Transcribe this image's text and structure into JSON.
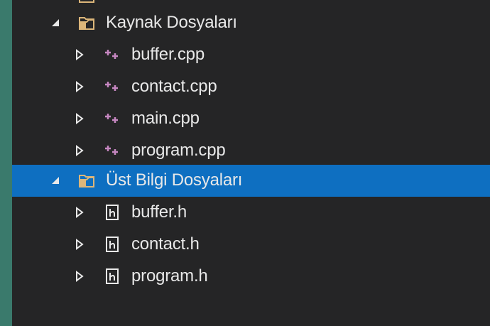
{
  "tree": {
    "items": [
      {
        "kind": "folder",
        "label": "Kaynak Dosyaları",
        "expanded": true,
        "selected": false
      },
      {
        "kind": "cpp",
        "label": "buffer.cpp"
      },
      {
        "kind": "cpp",
        "label": "contact.cpp"
      },
      {
        "kind": "cpp",
        "label": "main.cpp"
      },
      {
        "kind": "cpp",
        "label": "program.cpp"
      },
      {
        "kind": "folder",
        "label": "Üst Bilgi Dosyaları",
        "expanded": true,
        "selected": true
      },
      {
        "kind": "h",
        "label": "buffer.h"
      },
      {
        "kind": "h",
        "label": "contact.h"
      },
      {
        "kind": "h",
        "label": "program.h"
      }
    ]
  },
  "colors": {
    "background": "#252526",
    "selection": "#0e6fc1",
    "left_strip": "#3a7a6c",
    "text": "#e8e8e8",
    "cpp_icon": "#c586c0",
    "folder_icon": "#dcb67a"
  },
  "icons": {
    "folder": "folder-icon",
    "cpp": "cpp-file-icon",
    "h": "header-file-icon",
    "expanded": "triangle-expanded-icon",
    "collapsed": "triangle-collapsed-icon"
  }
}
